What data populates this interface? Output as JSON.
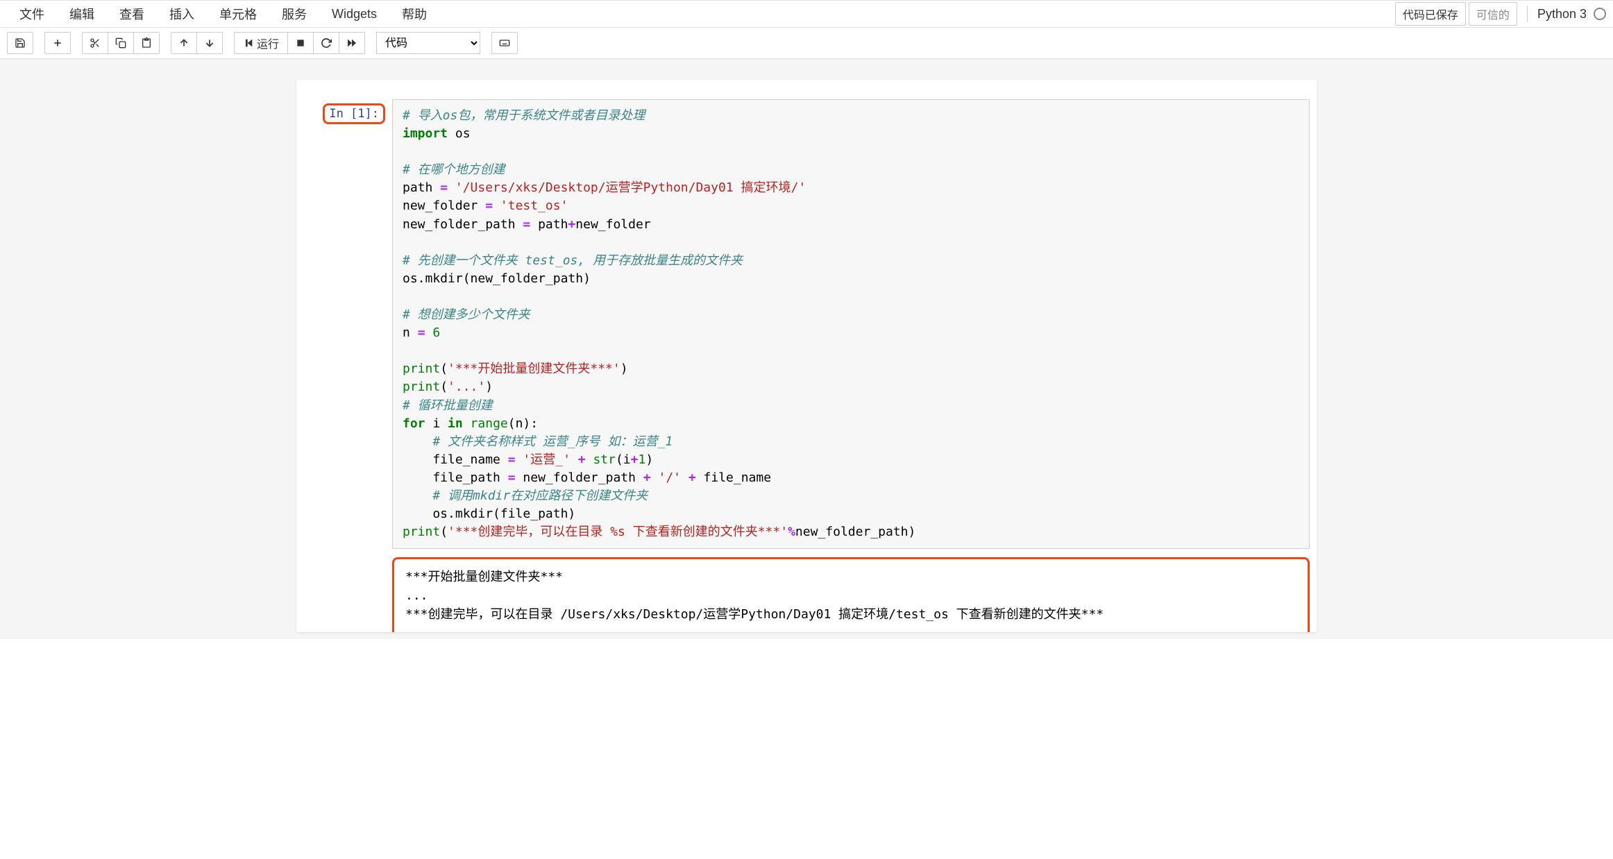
{
  "menubar": {
    "items": [
      "文件",
      "编辑",
      "查看",
      "插入",
      "单元格",
      "服务",
      "Widgets",
      "帮助"
    ],
    "saved_status": "代码已保存",
    "trusted_status": "可信的",
    "kernel_name": "Python 3"
  },
  "toolbar": {
    "save_title": "保存",
    "add_title": "添加单元格",
    "cut_title": "剪切",
    "copy_title": "复制",
    "paste_title": "粘贴",
    "up_title": "上移",
    "down_title": "下移",
    "run_label": "运行",
    "stop_title": "停止",
    "restart_title": "重启",
    "ff_title": "重启并运行全部",
    "cell_type_value": "代码",
    "cmd_title": "命令面板"
  },
  "cell1": {
    "prompt": "In [1]:",
    "code": {
      "l01_comment": "# 导入os包，常用于系统文件或者目录处理",
      "l02_kw": "import",
      "l02_mod": " os",
      "l04_comment": "# 在哪个地方创建",
      "l05_var": "path ",
      "l05_op": "=",
      "l05_str": " '/Users/xks/Desktop/运营学Python/Day01 搞定环境/'",
      "l06_var": "new_folder ",
      "l06_op": "=",
      "l06_str": " 'test_os'",
      "l07_var": "new_folder_path ",
      "l07_op": "=",
      "l07_rhs": " path",
      "l07_plus": "+",
      "l07_rhs2": "new_folder",
      "l09_comment": "# 先创建一个文件夹 test_os, 用于存放批量生成的文件夹",
      "l10": "os.mkdir(new_folder_path)",
      "l12_comment": "# 想创建多少个文件夹",
      "l13_var": "n ",
      "l13_op": "=",
      "l13_num": " 6",
      "l15_fn": "print",
      "l15_str": "'***开始批量创建文件夹***'",
      "l16_fn": "print",
      "l16_str": "'...'",
      "l17_comment": "# 循环批量创建",
      "l18_for": "for",
      "l18_i": " i ",
      "l18_in": "in",
      "l18_range": " range",
      "l18_n": "(n):",
      "l19_comment": "    # 文件夹名称样式 运营_序号 如：运营_1",
      "l20_pre": "    file_name ",
      "l20_op": "=",
      "l20_str": " '运营_'",
      "l20_plus": " + ",
      "l20_str2": "str",
      "l20_paren": "(i",
      "l20_plus2": "+",
      "l20_one": "1",
      "l20_close": ")",
      "l21_pre": "    file_path ",
      "l21_op": "=",
      "l21_rhs": " new_folder_path ",
      "l21_plus": "+",
      "l21_str": " '/'",
      "l21_plus2": " + ",
      "l21_rhs2": "file_name",
      "l22_comment": "    # 调用mkdir在对应路径下创建文件夹",
      "l23": "    os.mkdir(file_path)",
      "l24_fn": "print",
      "l24_str": "'***创建完毕，可以在目录 %s 下查看新创建的文件夹***'",
      "l24_op": "%",
      "l24_var": "new_folder_path)"
    },
    "output": "***开始批量创建文件夹***\n...\n***创建完毕，可以在目录 /Users/xks/Desktop/运营学Python/Day01 搞定环境/test_os 下查看新创建的文件夹***"
  }
}
